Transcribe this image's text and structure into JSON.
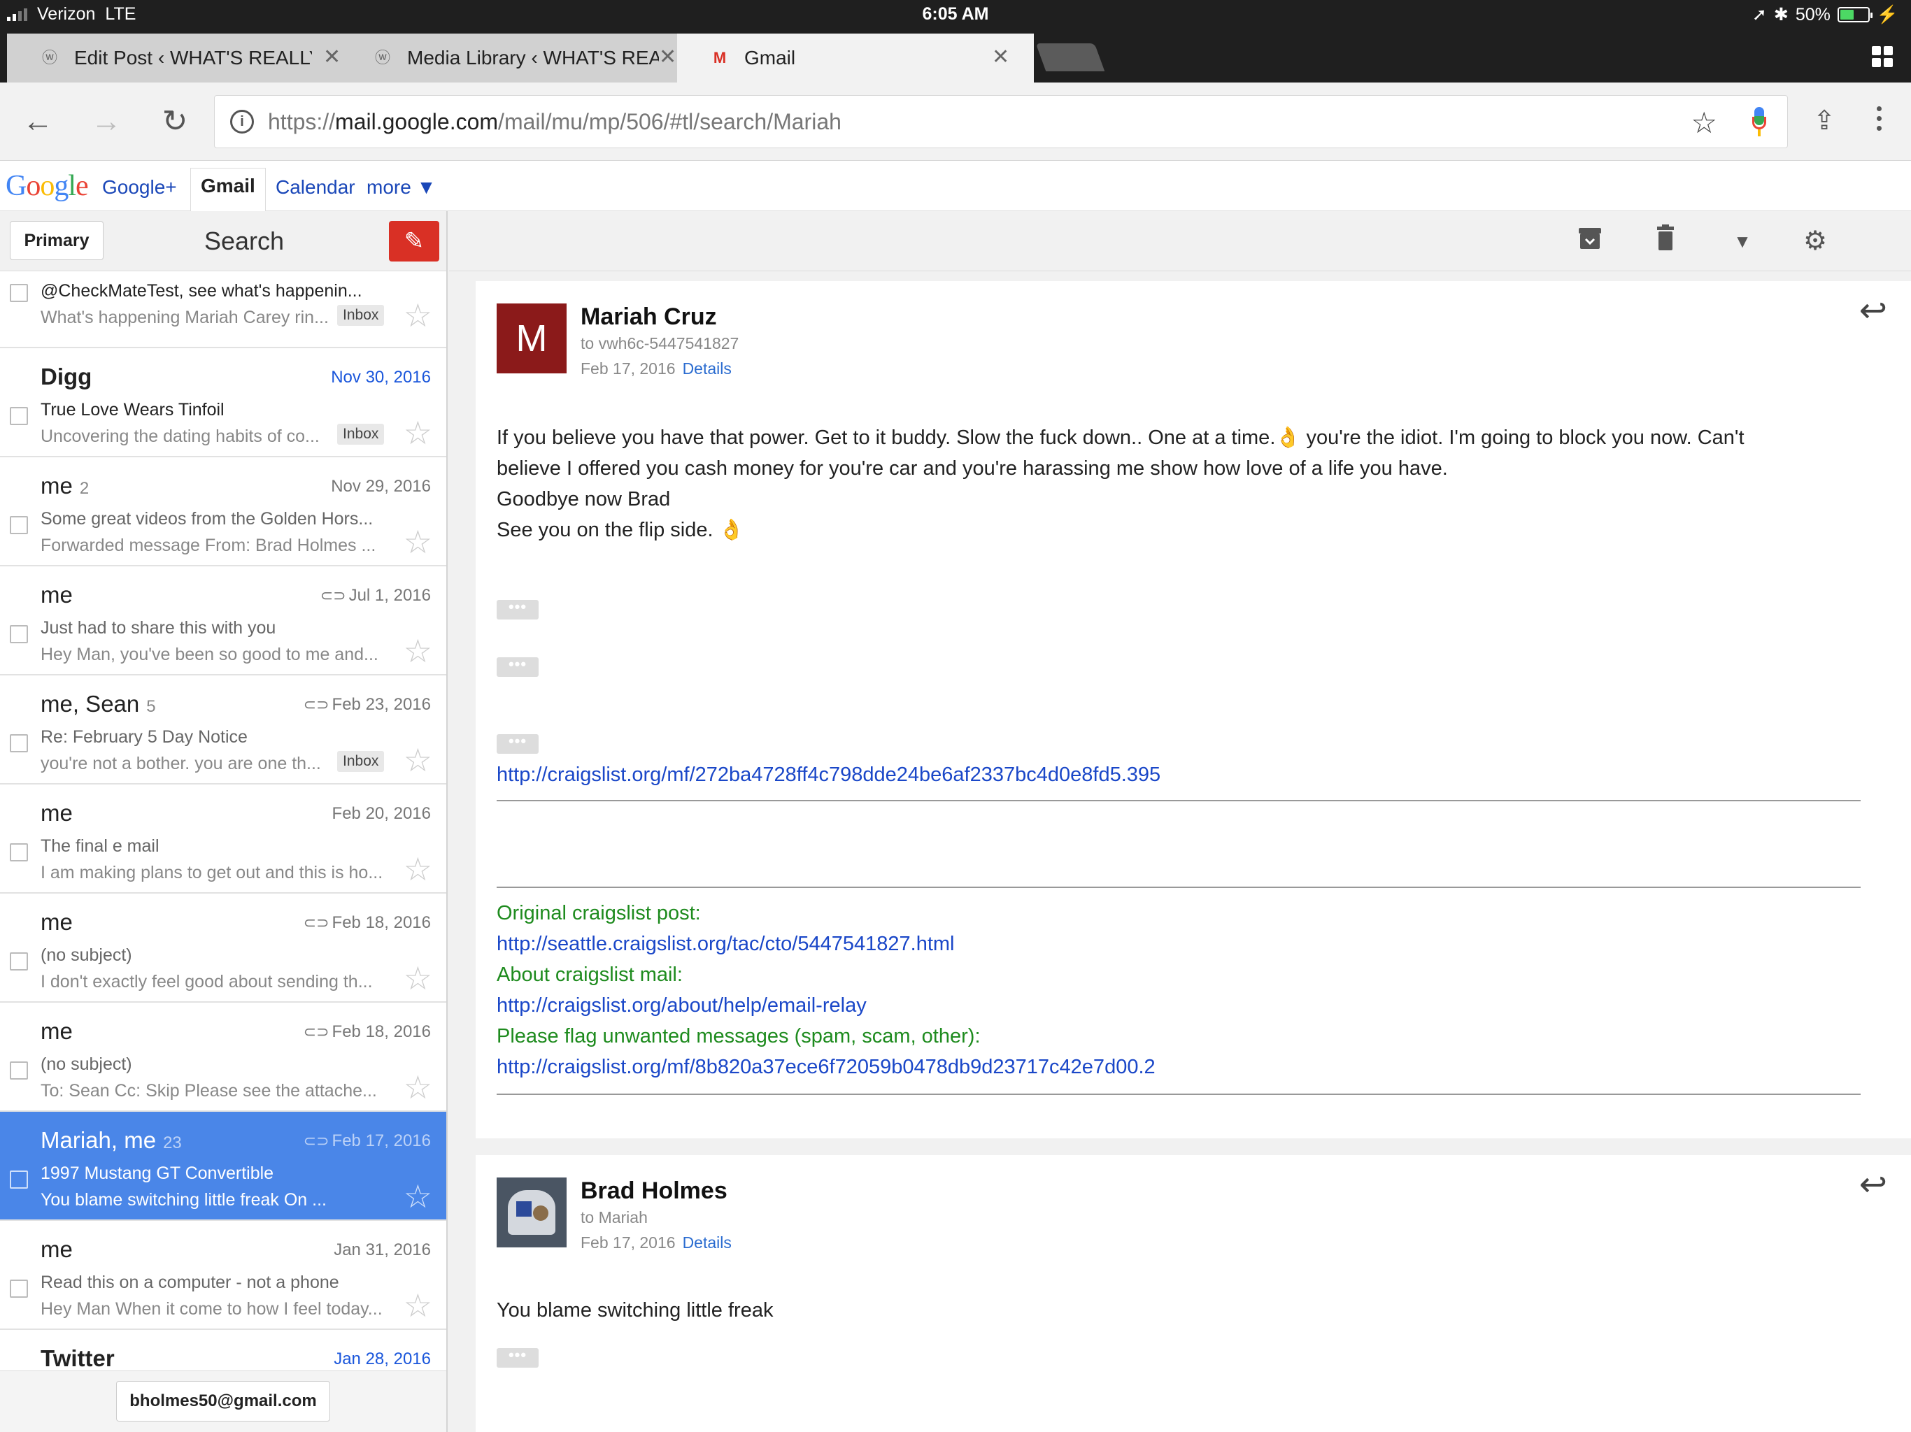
{
  "status_bar": {
    "carrier": "Verizon",
    "network": "LTE",
    "time": "6:05 AM",
    "battery_percent_label": "50%",
    "battery_level": 0.5
  },
  "tabs": [
    {
      "label": "Edit Post ‹ WHAT'S REALLY",
      "favicon": "wordpress-icon",
      "active": false
    },
    {
      "label": "Media Library ‹ WHAT'S REA",
      "favicon": "wordpress-icon",
      "active": false
    },
    {
      "label": "Gmail",
      "favicon": "gmail-icon",
      "active": true
    }
  ],
  "omnibox": {
    "scheme": "https://",
    "host": "mail.google.com",
    "path": "/mail/mu/mp/506/#tl/search/Mariah"
  },
  "google_bar": {
    "logo": "Google",
    "links": [
      "Google+",
      "Gmail",
      "Calendar",
      "more ▼"
    ]
  },
  "left_header": {
    "primary_label": "Primary",
    "title": "Search"
  },
  "threads": [
    {
      "from": "",
      "count": "",
      "date": "",
      "subject": "@CheckMateTest, see what's happenin...",
      "snippet": "What's happening Mariah Carey rin...",
      "badge": "Inbox",
      "attachment": false
    },
    {
      "from": "Digg",
      "count": "",
      "date": "Nov 30, 2016",
      "subject": "True Love Wears Tinfoil",
      "snippet": "Uncovering the dating habits of co...",
      "badge": "Inbox",
      "attachment": false
    },
    {
      "from": "me",
      "count": "2",
      "date": "Nov 29, 2016",
      "subject": "Some great videos from the Golden Hors...",
      "snippet": "Forwarded message From: Brad Holmes ...",
      "badge": "",
      "attachment": false
    },
    {
      "from": "me",
      "count": "",
      "date": "Jul 1, 2016",
      "subject": "Just had to share this with you",
      "snippet": "Hey Man, you've been so good to me and...",
      "badge": "",
      "attachment": true
    },
    {
      "from": "me, Sean",
      "count": "5",
      "date": "Feb 23, 2016",
      "subject": "Re: February 5 Day Notice",
      "snippet": "you're not a bother. you are one th...",
      "badge": "Inbox",
      "attachment": true
    },
    {
      "from": "me",
      "count": "",
      "date": "Feb 20, 2016",
      "subject": "The final e mail",
      "snippet": "I am making plans to get out and this is ho...",
      "badge": "",
      "attachment": false
    },
    {
      "from": "me",
      "count": "",
      "date": "Feb 18, 2016",
      "subject": "(no subject)",
      "snippet": "I don't exactly feel good about sending th...",
      "badge": "",
      "attachment": true
    },
    {
      "from": "me",
      "count": "",
      "date": "Feb 18, 2016",
      "subject": "(no subject)",
      "snippet": "To: Sean Cc: Skip Please see the attache...",
      "badge": "",
      "attachment": true
    },
    {
      "from": "Mariah, me",
      "count": "23",
      "date": "Feb 17, 2016",
      "subject": "1997 Mustang GT Convertible",
      "snippet": "You blame switching little freak On ...",
      "badge": "",
      "attachment": true
    },
    {
      "from": "me",
      "count": "",
      "date": "Jan 31, 2016",
      "subject": "Read this on a computer - not a phone",
      "snippet": "Hey Man When it come to how I feel today...",
      "badge": "",
      "attachment": false
    },
    {
      "from": "Twitter",
      "count": "",
      "date": "Jan 28, 2016",
      "subject": "",
      "snippet": "",
      "badge": "",
      "attachment": false
    }
  ],
  "account": "bholmes50@gmail.com",
  "message1": {
    "avatar_letter": "M",
    "sender": "Mariah Cruz",
    "to": "to vwh6c-5447541827",
    "date": "Feb 17, 2016",
    "details": "Details",
    "body_line1": "If you believe you have that power. Get to it buddy. Slow the fuck down.. One at a time.👌 you're the idiot. I'm going to block you now. Can't",
    "body_line2": "believe I offered you cash money for you're car and you're harassing me show how love of a life you have.",
    "body_line3": "Goodbye now Brad",
    "body_line4": "See you on the flip side. 👌",
    "ellipsis": "•••",
    "link1": "http://craigslist.org/mf/272ba4728ff4c798dde24be6af2337bc4d0e8fd5.395",
    "orig_label": "Original craigslist post:",
    "orig_link": "http://seattle.craigslist.org/tac/cto/5447541827.html",
    "about_label": "About craigslist mail:",
    "about_link": "http://craigslist.org/about/help/email-relay",
    "flag_label": "Please flag unwanted messages (spam, scam, other):",
    "flag_link": "http://craigslist.org/mf/8b820a37ece6f72059b0478db9d23717c42e7d00.2"
  },
  "message2": {
    "sender": "Brad Holmes",
    "to": "to Mariah",
    "date": "Feb 17, 2016",
    "details": "Details",
    "body": "You blame switching little freak",
    "ellipsis": "•••"
  }
}
